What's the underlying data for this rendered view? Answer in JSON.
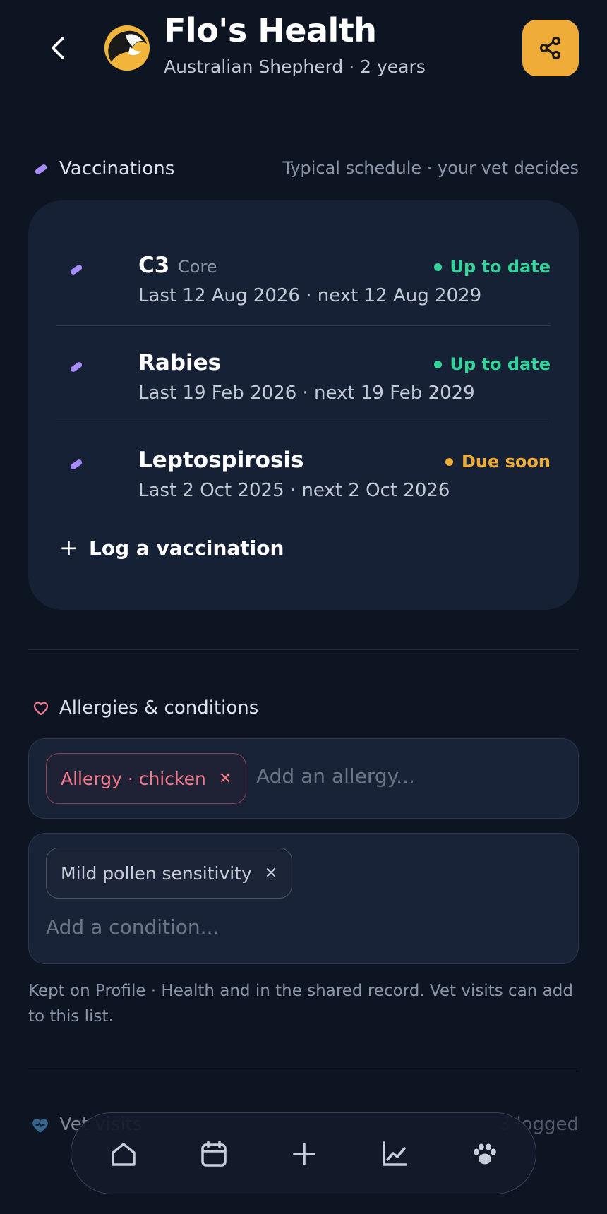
{
  "header": {
    "title": "Flo's Health",
    "subtitle": "Australian Shepherd · 2 years",
    "back_icon": "chevron-left-icon",
    "share_icon": "share-icon",
    "share_color": "#f0ac38"
  },
  "vaccinations": {
    "title": "Vaccinations",
    "note": "Typical schedule · your vet decides",
    "items": [
      {
        "name": "C3",
        "tag": "Core",
        "dates": "Last 12 Aug 2026 · next 12 Aug 2029",
        "status": "Up to date",
        "status_color": "#34d399"
      },
      {
        "name": "Rabies",
        "tag": "",
        "dates": "Last 19 Feb 2026 · next 19 Feb 2029",
        "status": "Up to date",
        "status_color": "#34d399"
      },
      {
        "name": "Leptospirosis",
        "tag": "",
        "dates": "Last 2 Oct 2025 · next 2 Oct 2026",
        "status": "Due soon",
        "status_color": "#f0ac38"
      }
    ],
    "log_label": "Log a vaccination"
  },
  "allergies": {
    "title": "Allergies & conditions",
    "allergy_chips": [
      "Allergy · chicken"
    ],
    "allergy_placeholder": "Add an allergy...",
    "condition_chips": [
      "Mild pollen sensitivity"
    ],
    "condition_placeholder": "Add a condition...",
    "helper": "Kept on Profile · Health and in the shared record. Vet visits can add to this list."
  },
  "vet_visits": {
    "title": "Vet visits",
    "count": "3 logged"
  },
  "nav": {
    "items": [
      "home-icon",
      "calendar-icon",
      "plus-icon",
      "chart-icon",
      "paw-icon"
    ]
  },
  "colors": {
    "background": "#0d1422",
    "card": "#162136",
    "accent": "#f0ac38",
    "success": "#34d399",
    "allergy": "#f47b8c",
    "syringe": "#a78bfa"
  }
}
